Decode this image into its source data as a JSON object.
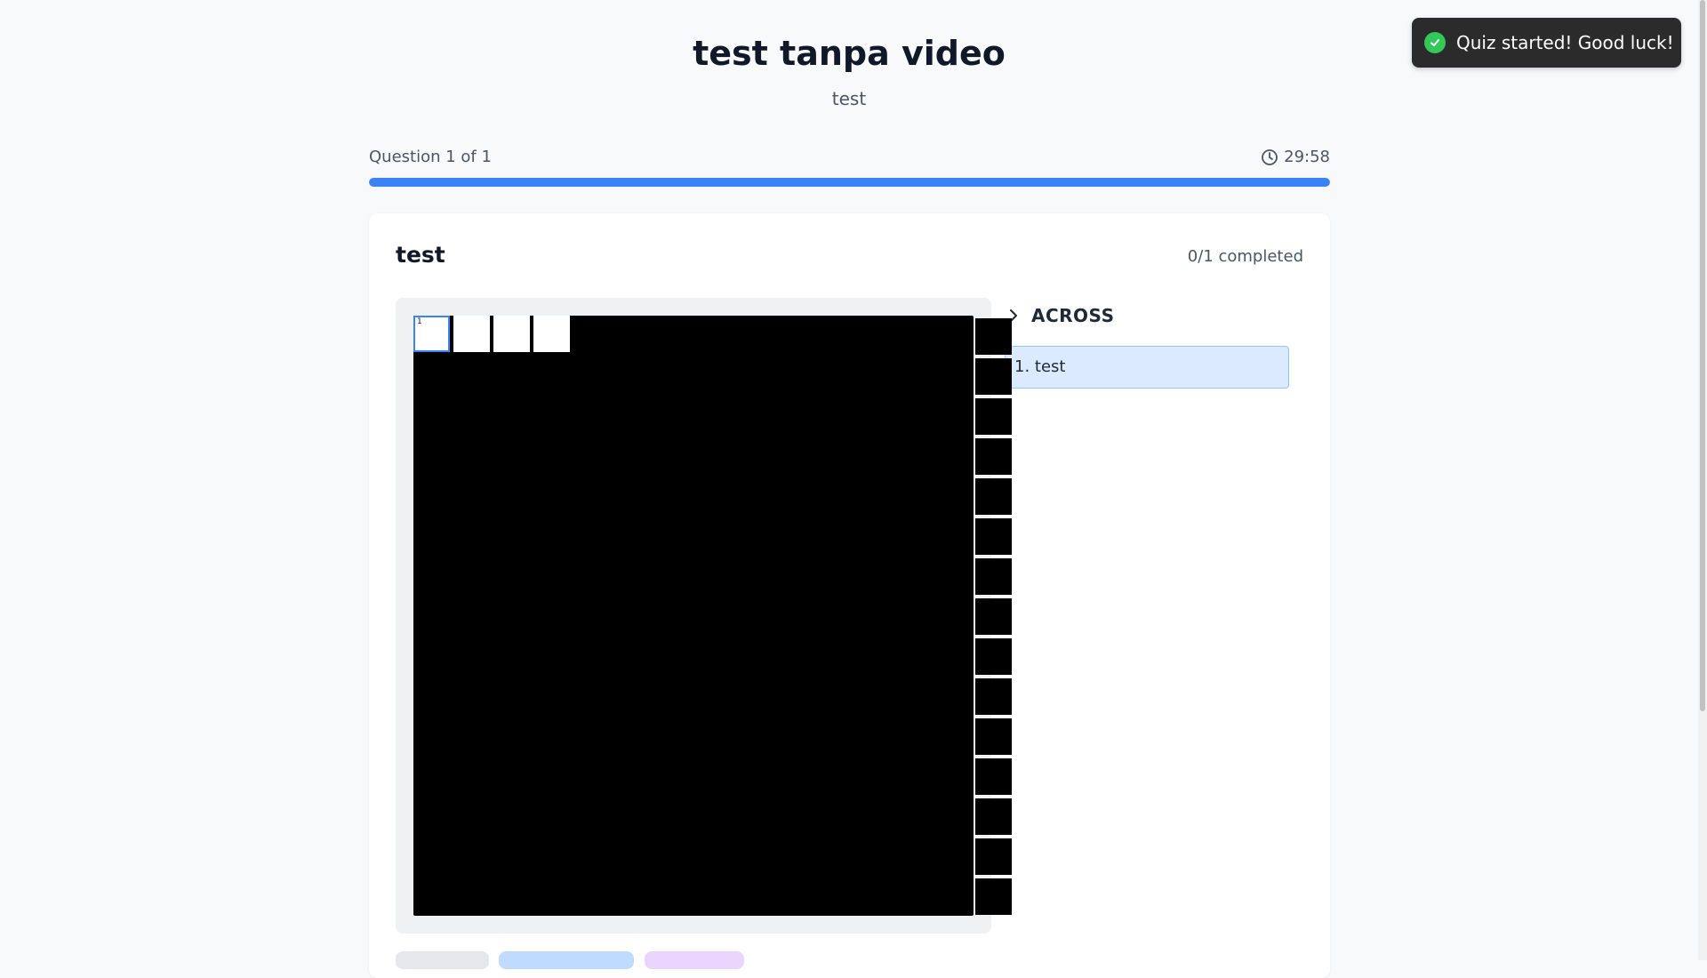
{
  "quiz": {
    "title": "test tanpa video",
    "subtitle": "test"
  },
  "progress": {
    "question_label": "Question 1 of 1",
    "timer": "29:58",
    "fraction": 1.0,
    "bar_color": "#3b82f6"
  },
  "question": {
    "title": "test",
    "status": "0/1 completed"
  },
  "crossword": {
    "white_cells": 4,
    "first_cell_number": "1",
    "side_blocks": 15
  },
  "clues": {
    "section_label": "ACROSS",
    "items": [
      {
        "label": "1. test"
      }
    ]
  },
  "toast": {
    "message": "Quiz started! Good luck!",
    "icon": "check-circle-icon"
  },
  "colors": {
    "accent": "#3b82f6",
    "clue_highlight": "#dbeafe",
    "toast_bg": "#2b2b2b",
    "success": "#34c759"
  }
}
